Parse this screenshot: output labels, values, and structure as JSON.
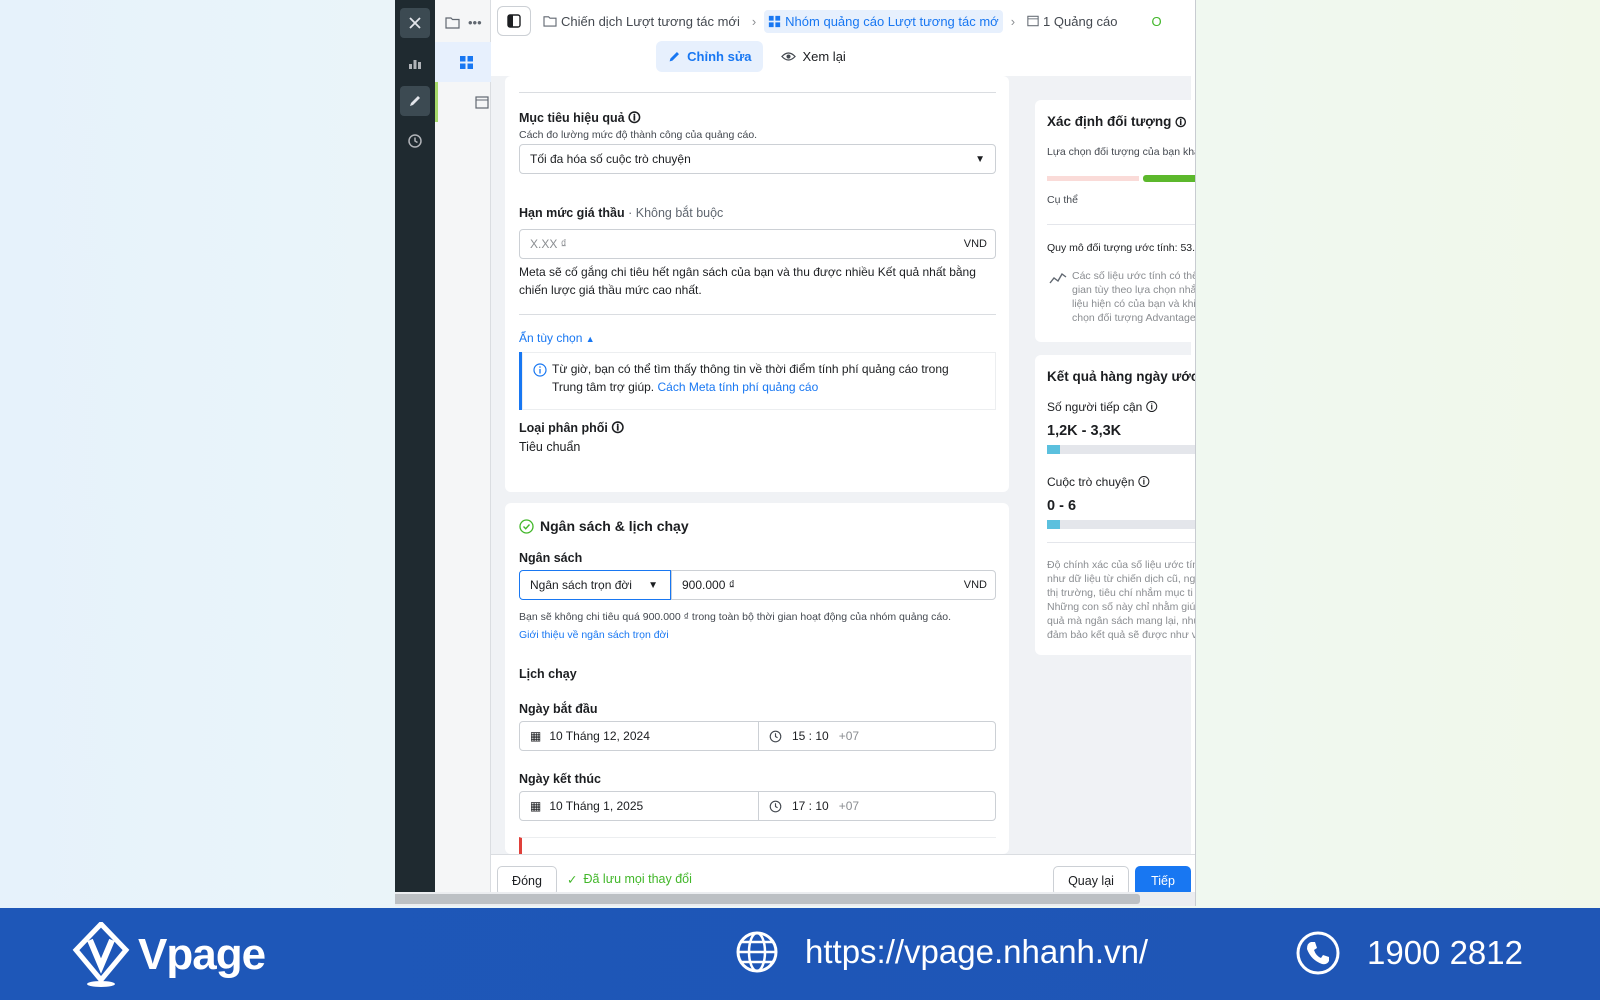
{
  "breadcrumb": {
    "campaign": "Chiến dịch Lượt tương tác mới",
    "adset": "Nhóm quảng cáo Lượt tương tác mớ",
    "ad": "1 Quảng cáo",
    "more": "O"
  },
  "modes": {
    "edit": "Chỉnh sửa",
    "review": "Xem lại"
  },
  "goal": {
    "label": "Mục tiêu hiệu quả",
    "desc": "Cách đo lường mức độ thành công của quảng cáo.",
    "value": "Tối đa hóa số cuộc trò chuyện"
  },
  "bid": {
    "label": "Hạn mức giá thầu",
    "optional": "· Không bắt buộc",
    "placeholder": "X.XX ₫",
    "unit": "VND",
    "help_line1": "Meta sẽ cố gắng chi tiêu hết ngân sách của bạn và thu được nhiều Kết quả nhất bằng",
    "help_line2": "chiến lược giá thầu mức cao nhất."
  },
  "options": {
    "toggle": "Ẩn tùy chọn",
    "notice_line1": "Từ giờ, bạn có thể tìm thấy thông tin về thời điểm tính phí quảng cáo trong",
    "notice_line2a": "Trung tâm trợ giúp.",
    "notice_link": "Cách Meta tính phí quảng cáo"
  },
  "delivery": {
    "label": "Loại phân phối",
    "value": "Tiêu chuẩn"
  },
  "budget_section": {
    "title": "Ngân sách & lịch chạy",
    "budget_label": "Ngân sách",
    "budget_type": "Ngân sách trọn đời",
    "budget_amount": "900.000 ₫",
    "unit": "VND",
    "note": "Bạn sẽ không chi tiêu quá 900.000 ₫ trong toàn bộ thời gian hoạt động của nhóm quảng cáo.",
    "note_link": "Giới thiệu về ngân sách trọn đời",
    "schedule_label": "Lịch chạy",
    "start_label": "Ngày bắt đầu",
    "start_date": "10 Tháng 12, 2024",
    "start_time": "15 : 10",
    "start_tz": "+07",
    "end_label": "Ngày kết thúc",
    "end_date": "10 Tháng 1, 2025",
    "end_time": "17 : 10",
    "end_tz": "+07"
  },
  "audience": {
    "title": "Xác định đối tượng",
    "desc": "Lựa chọn đối tượng của bạn khá",
    "specific": "Cụ thể",
    "size": "Quy mô đối tượng ước tính: 53.",
    "note_lines": [
      "Các số liệu ước tính có thể",
      "gian tùy theo lựa chọn nhắ",
      "liệu hiện có của bạn và khi",
      "chọn đối tượng Advantage"
    ]
  },
  "daily": {
    "title": "Kết quả hàng ngày ước",
    "reach_label": "Số người tiếp cận",
    "reach_value": "1,2K - 3,3K",
    "reach_fill": 0.08,
    "conv_label": "Cuộc trò chuyện",
    "conv_value": "0 - 6",
    "conv_fill": 0.08,
    "disclaimer_lines": [
      "Độ chính xác của số liệu ước tín",
      "như dữ liệu từ chiến dịch cũ, ng",
      "thị trường, tiêu chí nhắm mục ti",
      "Những con số này chỉ nhằm giú",
      "quả mà ngân sách mang lại, nhu",
      "đảm bảo kết quả sẽ được như v"
    ]
  },
  "footer": {
    "close": "Đóng",
    "saved": "Đã lưu mọi thay đổi",
    "back": "Quay lại",
    "next": "Tiếp"
  },
  "banner": {
    "brand": "Vpage",
    "url": "https://vpage.nhanh.vn/",
    "phone": "1900 2812"
  },
  "colors": {
    "brand_blue": "#1e57b8",
    "meta_blue": "#1877f2",
    "rail": "#1f2a30"
  }
}
